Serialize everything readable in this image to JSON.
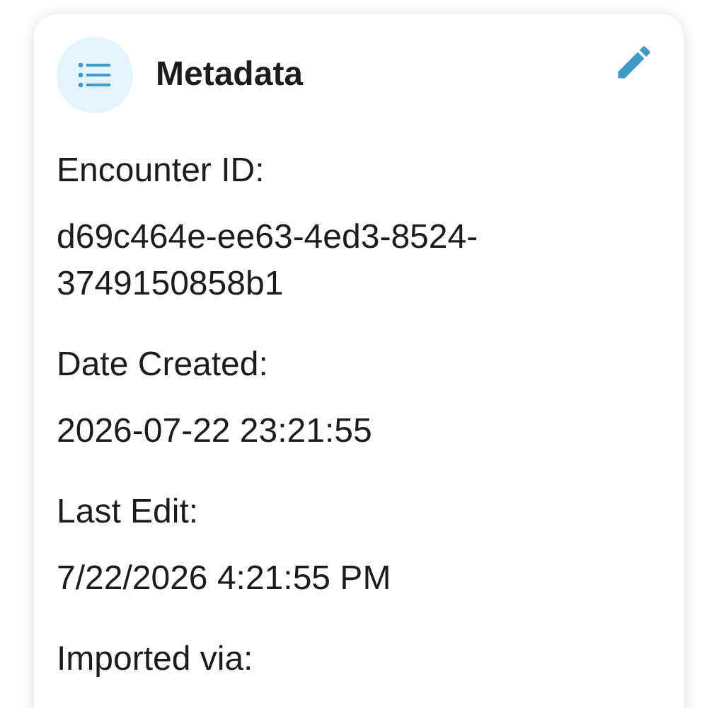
{
  "card": {
    "title": "Metadata",
    "fields": [
      {
        "label": "Encounter ID:",
        "value": "d69c464e-ee63-4ed3-8524-3749150858b1"
      },
      {
        "label": "Date Created:",
        "value": "2026-07-22 23:21:55"
      },
      {
        "label": "Last Edit:",
        "value": "7/22/2026 4:21:55 PM"
      },
      {
        "label": "Imported via:"
      }
    ]
  }
}
